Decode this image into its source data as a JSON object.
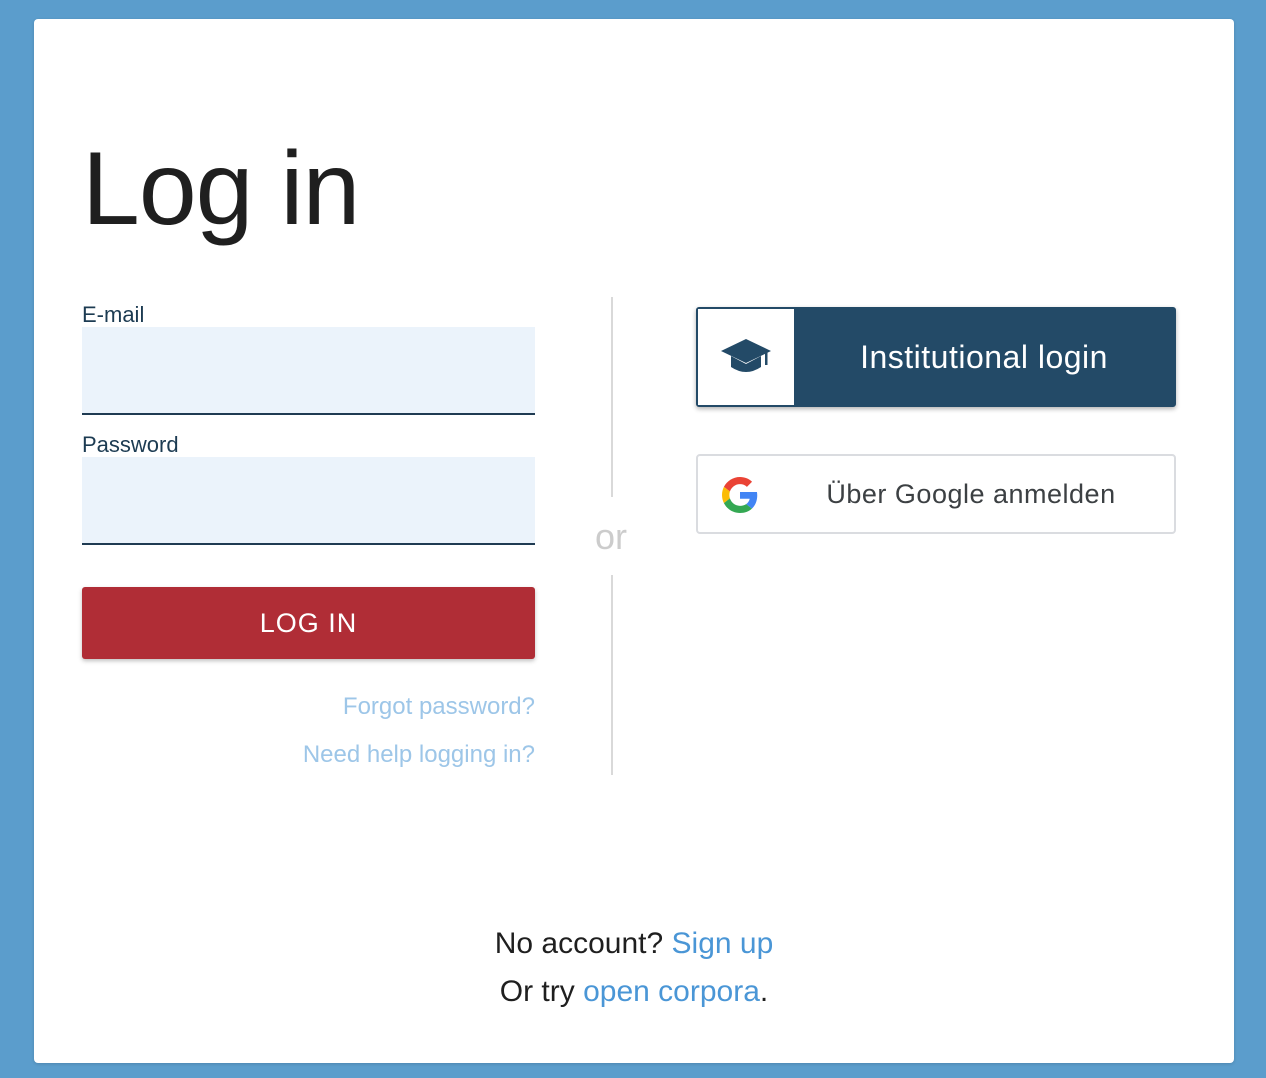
{
  "page": {
    "title": "Log in"
  },
  "form": {
    "email_label": "E-mail",
    "email_value": "",
    "password_label": "Password",
    "password_value": "",
    "login_button": "LOG IN",
    "forgot_password": "Forgot password?",
    "need_help": "Need help logging in?"
  },
  "divider": {
    "or_text": "or"
  },
  "alt_login": {
    "institutional": {
      "label": "Institutional login",
      "icon": "graduation-cap-icon"
    },
    "google": {
      "label": "Über Google anmelden",
      "icon": "google-g-icon"
    }
  },
  "footer": {
    "no_account_prefix": "No account?",
    "sign_up": "Sign up",
    "or_try_prefix": "Or try",
    "open_corpora": "open corpora",
    "suffix": "."
  },
  "colors": {
    "background": "#5b9dcc",
    "primary_red": "#b02d36",
    "institutional_blue": "#234a67",
    "link_blue": "#4a96d6",
    "muted_link": "#9dc6e8",
    "input_bg": "#ebf3fb"
  }
}
